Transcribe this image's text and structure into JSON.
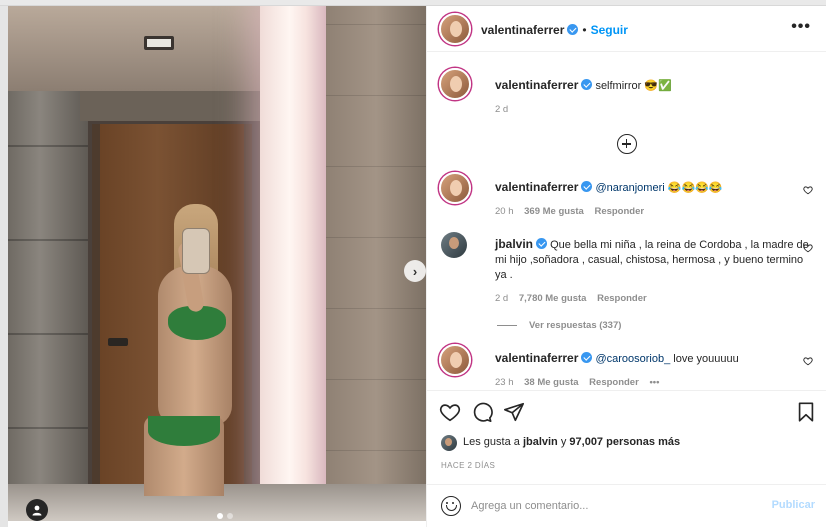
{
  "post": {
    "username": "valentinaferrer",
    "follow_label": "Seguir",
    "bullet": "•",
    "more_label": "•••"
  },
  "caption": {
    "username": "valentinaferrer",
    "text": "selfmirror 😎✅",
    "time": "2 d"
  },
  "comments": [
    {
      "username": "valentinaferrer",
      "mention": "@naranjomeri",
      "text": " 😂😂😂😂",
      "time": "20 h",
      "likes": "369 Me gusta",
      "reply_label": "Responder"
    },
    {
      "username": "jbalvin",
      "mention": "",
      "text": "Que bella mi niña , la reina de Cordoba , la madre de mi hijo ,soñadora , casual, chistosa, hermosa , y bueno termino ya .",
      "time": "2 d",
      "likes": "7,780 Me gusta",
      "reply_label": "Responder",
      "view_replies": "Ver respuestas (337)"
    },
    {
      "username": "valentinaferrer",
      "mention": "@caroosoriob_",
      "text": " love youuuuu",
      "time": "23 h",
      "likes": "38 Me gusta",
      "reply_label": "Responder",
      "extra": "•••"
    }
  ],
  "likes_line": {
    "prefix": "Les gusta a ",
    "user": "jbalvin",
    "middle": " y ",
    "count": "97,007 personas más"
  },
  "posted_ago": "HACE 2 DÍAS",
  "comment_box": {
    "placeholder": "Agrega un comentario...",
    "publish_label": "Publicar"
  },
  "carousel": {
    "slides": 2,
    "active_index": 0
  },
  "colors": {
    "accent": "#0095f6",
    "verified": "#3897f0",
    "muted": "#8e8e8e",
    "text": "#262626",
    "publish_disabled": "#b3dbff"
  }
}
